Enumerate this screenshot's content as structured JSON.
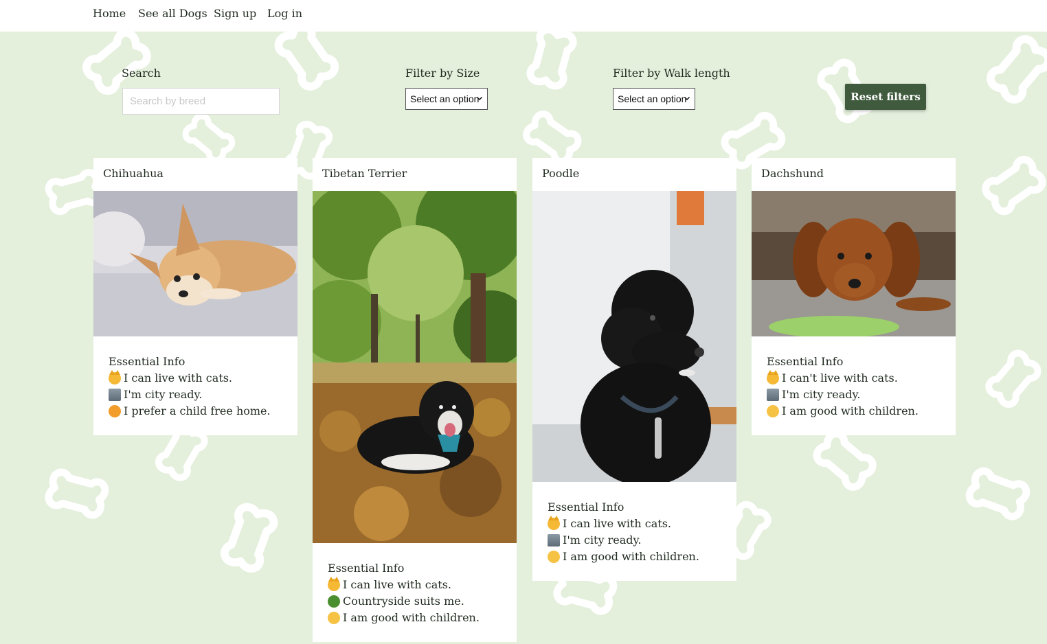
{
  "nav": {
    "items": [
      "Home",
      "See all Dogs",
      "Sign up",
      "Log in"
    ]
  },
  "filters": {
    "search_label": "Search",
    "search_placeholder": "Search by breed",
    "size_label": "Filter by Size",
    "size_selected": "Select an option",
    "walk_label": "Filter by Walk length",
    "walk_selected": "Select an option",
    "reset_label": "Reset filters"
  },
  "colors": {
    "background": "#e4efdc",
    "accent_button": "#3f5a3c",
    "card": "#ffffff"
  },
  "cards": [
    {
      "title": "Chihuahua",
      "info_heading": "Essential Info",
      "rows": [
        {
          "icon": "cat-face-icon",
          "text": "I can live with cats."
        },
        {
          "icon": "city-building-icon",
          "text": "I'm city ready."
        },
        {
          "icon": "child-no-icon",
          "text": "I prefer a child free home."
        }
      ]
    },
    {
      "title": "Tibetan Terrier",
      "info_heading": "Essential Info",
      "rows": [
        {
          "icon": "cat-face-icon",
          "text": "I can live with cats."
        },
        {
          "icon": "tree-icon",
          "text": "Countryside suits me."
        },
        {
          "icon": "child-face-icon",
          "text": "I am good with children."
        }
      ]
    },
    {
      "title": "Poodle",
      "info_heading": "Essential Info",
      "rows": [
        {
          "icon": "cat-face-icon",
          "text": "I can live with cats."
        },
        {
          "icon": "city-building-icon",
          "text": "I'm city ready."
        },
        {
          "icon": "child-face-icon",
          "text": "I am good with children."
        }
      ]
    },
    {
      "title": "Dachshund",
      "info_heading": "Essential Info",
      "rows": [
        {
          "icon": "cat-face-icon",
          "text": "I can't live with cats."
        },
        {
          "icon": "city-building-icon",
          "text": "I'm city ready."
        },
        {
          "icon": "child-face-icon",
          "text": "I am good with children."
        }
      ]
    }
  ]
}
